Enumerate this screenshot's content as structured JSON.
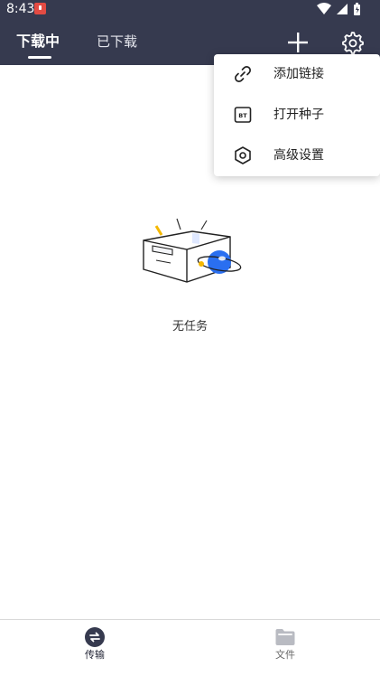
{
  "status_bar": {
    "time": "8:43"
  },
  "header": {
    "tabs": [
      {
        "label": "下载中",
        "active": true
      },
      {
        "label": "已下载",
        "active": false
      }
    ]
  },
  "menu": {
    "items": [
      {
        "label": "添加链接",
        "icon": "link-icon"
      },
      {
        "label": "打开种子",
        "icon": "bt-icon",
        "badge": "BT"
      },
      {
        "label": "高级设置",
        "icon": "hexagon-settings-icon"
      }
    ]
  },
  "main": {
    "empty_text": "无任务"
  },
  "bottom_nav": {
    "items": [
      {
        "label": "传输",
        "icon": "transfer-icon",
        "active": true
      },
      {
        "label": "文件",
        "icon": "folder-icon",
        "active": false
      }
    ]
  },
  "colors": {
    "header_bg": "#363a4f",
    "accent_blue": "#2a6ff0",
    "accent_yellow": "#f5b800"
  }
}
